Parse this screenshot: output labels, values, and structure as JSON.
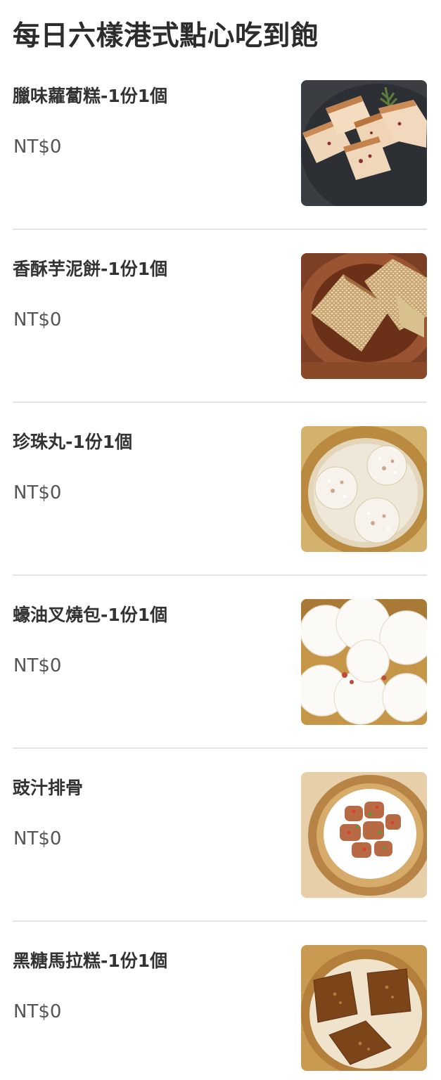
{
  "section": {
    "title": "每日六樣港式點心吃到飽"
  },
  "items": [
    {
      "name": "臘味蘿蔔糕-1份1個",
      "price": "NT$0",
      "image_icon": "turnip-cake-photo"
    },
    {
      "name": "香酥芋泥餅-1份1個",
      "price": "NT$0",
      "image_icon": "taro-cake-photo"
    },
    {
      "name": "珍珠丸-1份1個",
      "price": "NT$0",
      "image_icon": "pearl-balls-photo"
    },
    {
      "name": "蠔油叉燒包-1份1個",
      "price": "NT$0",
      "image_icon": "char-siu-bao-photo"
    },
    {
      "name": "豉汁排骨",
      "price": "NT$0",
      "image_icon": "steamed-spare-ribs-photo"
    },
    {
      "name": "黑糖馬拉糕-1份1個",
      "price": "NT$0",
      "image_icon": "brown-sugar-cake-photo"
    }
  ],
  "colors": {
    "text_primary": "#333333",
    "text_price": "#555555",
    "divider": "#e4e4e4",
    "background": "#ffffff"
  }
}
